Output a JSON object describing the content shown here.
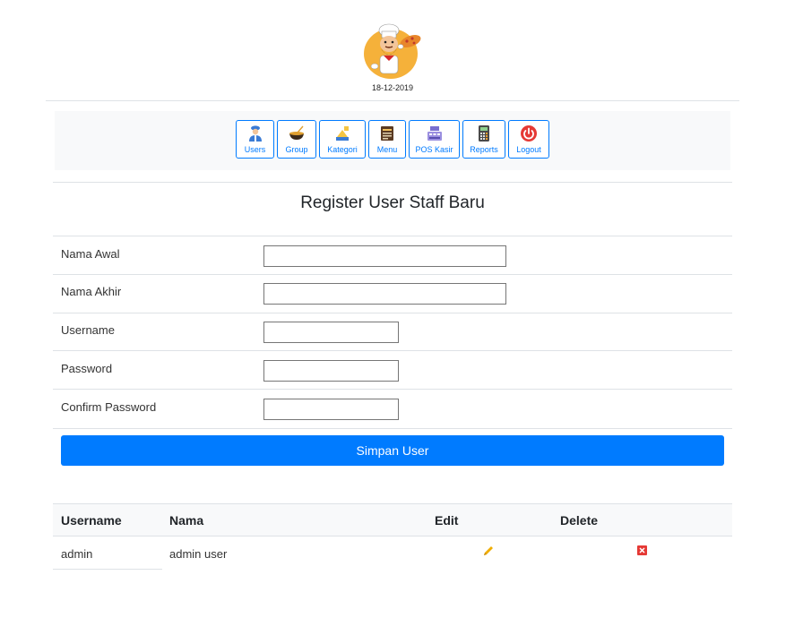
{
  "header": {
    "logo": "chef-logo",
    "date": "18-12-2019"
  },
  "nav": {
    "items": [
      {
        "label": "Users",
        "icon": "user-staff-icon"
      },
      {
        "label": "Group",
        "icon": "bowl-icon"
      },
      {
        "label": "Kategori",
        "icon": "category-icon"
      },
      {
        "label": "Menu",
        "icon": "menu-book-icon"
      },
      {
        "label": "POS Kasir",
        "icon": "cash-register-icon"
      },
      {
        "label": "Reports",
        "icon": "calculator-icon"
      },
      {
        "label": "Logout",
        "icon": "power-icon"
      }
    ]
  },
  "form": {
    "title": "Register User Staff Baru",
    "fields": [
      {
        "label": "Nama Awal",
        "value": ""
      },
      {
        "label": "Nama Akhir",
        "value": ""
      },
      {
        "label": "Username",
        "value": ""
      },
      {
        "label": "Password",
        "value": ""
      },
      {
        "label": "Confirm Password",
        "value": ""
      }
    ],
    "submit_label": "Simpan User"
  },
  "table": {
    "headers": [
      "Username",
      "Nama",
      "Edit",
      "Delete"
    ],
    "rows": [
      {
        "username": "admin",
        "nama": "admin user"
      }
    ]
  },
  "colors": {
    "primary": "#007bff",
    "edit_icon": "#f0ad00",
    "delete_icon": "#e53935"
  }
}
